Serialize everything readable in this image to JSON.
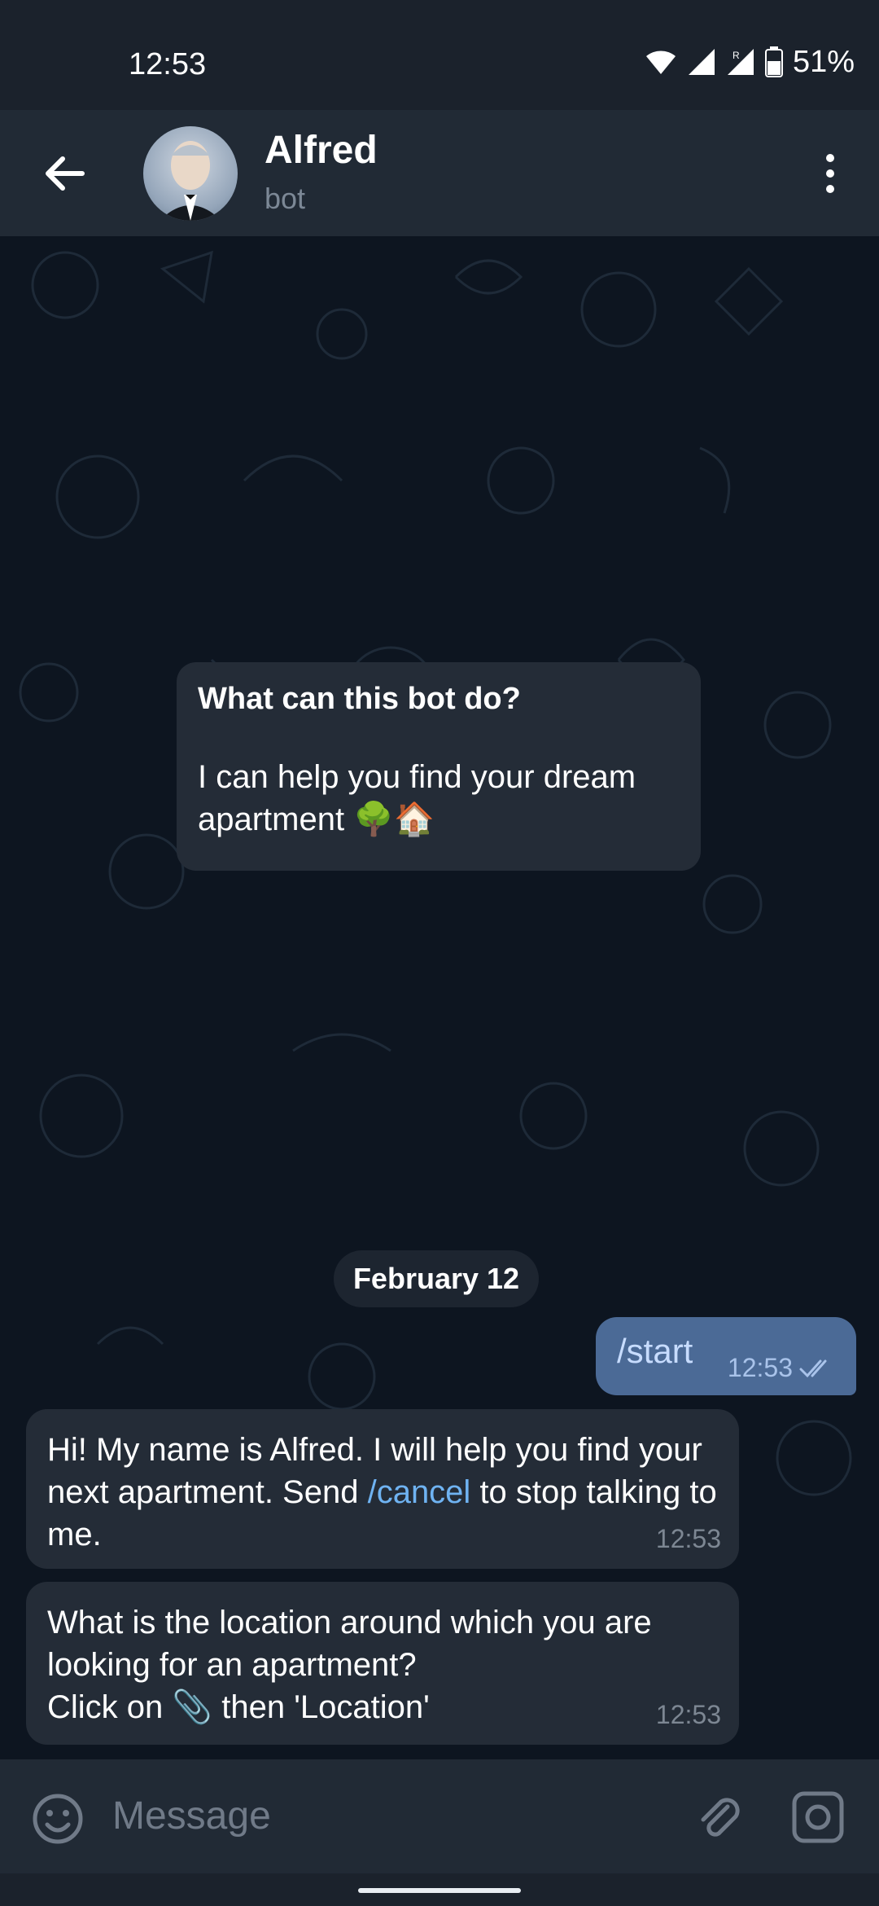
{
  "status_bar": {
    "time": "12:53",
    "battery": "51%",
    "icons": [
      "wifi-icon",
      "signal-icon",
      "signal-roaming-icon",
      "battery-icon"
    ]
  },
  "header": {
    "title": "Alfred",
    "subtitle": "bot",
    "back_icon": "arrow-left-icon",
    "menu_icon": "more-vertical-icon"
  },
  "bot_info": {
    "title": "What can this bot do?",
    "text": "I can help you find your dream apartment 🌳🏠"
  },
  "date_separator": "February 12",
  "messages": [
    {
      "direction": "out",
      "text": "/start",
      "time": "12:53",
      "status": "read"
    },
    {
      "direction": "in",
      "text_before": "Hi! My name is Alfred. I will help you find your next apartment. Send ",
      "link": "/cancel",
      "text_after": " to stop talking to me.",
      "time": "12:53"
    },
    {
      "direction": "in",
      "text": "What is the location around which you are looking for an apartment?\nClick on 📎 then 'Location'",
      "time": "12:53"
    }
  ],
  "composer": {
    "placeholder": "Message",
    "icons": [
      "emoji-icon",
      "paperclip-icon",
      "camera-icon"
    ]
  },
  "colors": {
    "background": "#0d1520",
    "header": "#212a35",
    "bubble_in": "#242c37",
    "bubble_out": "#4b6a96",
    "link": "#6fb3f2"
  }
}
